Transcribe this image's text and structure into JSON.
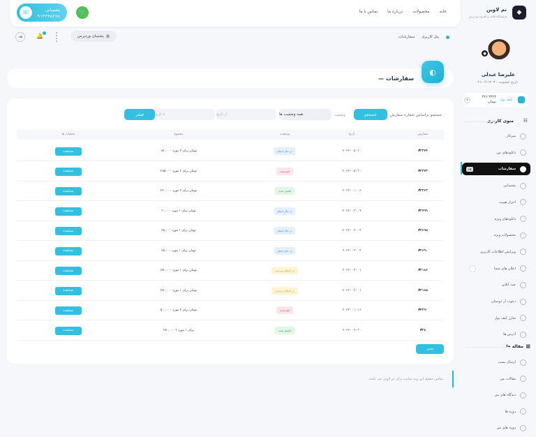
{
  "header": {
    "site_name": "تم لاوین",
    "site_tagline": "فروشگاه قالب و افزونه وردپرس",
    "nav": [
      "خانه",
      "محصولات",
      "درباره ما",
      "تماس با ما"
    ],
    "support_label": "پشتیبانی",
    "support_phone": "۰۹۱۳۳۴۵۶۷۸",
    "support_icon": "phone-icon",
    "cart_icon": "cart-icon"
  },
  "subbar": {
    "breadcrumb": [
      "پنل کاربری",
      "سفارشات"
    ],
    "wp_support": "پشتیبان وردپرس"
  },
  "profile": {
    "name": "علیرضا عبدلی",
    "reg_date": "تاریخ عضویت : ۱۴۰۳-۰۳-۲۱",
    "wallet_label": "کیف پول",
    "wallet_amount": "۳۳۶۳ ۳۶۶",
    "wallet_unit": "تومان",
    "wallet_plus": "+"
  },
  "sidebar": {
    "section1": "منوی کاربری",
    "items": [
      {
        "label": "میزکار",
        "icon": "dashboard-icon"
      },
      {
        "label": "دانلودهای من",
        "icon": "download-icon"
      },
      {
        "label": "سفارشات",
        "icon": "orders-icon",
        "active": true,
        "badge": "۱۷"
      },
      {
        "label": "پشتیبانی",
        "icon": "support-icon"
      },
      {
        "label": "احراز هویت",
        "icon": "id-icon"
      },
      {
        "label": "دانلودهای ویژه",
        "icon": "star-icon"
      },
      {
        "label": "محصولات ویژه",
        "icon": "pencil-icon"
      },
      {
        "label": "ویرایش اطلاعات کاربری",
        "icon": "edit-icon"
      },
      {
        "label": "اعلان های شما",
        "icon": "bell-icon",
        "circle": "۰"
      },
      {
        "label": "چت آنلاین",
        "icon": "chat-icon"
      },
      {
        "label": "دعوت از دوستان",
        "icon": "invite-icon"
      },
      {
        "label": "شارژ کیف پول",
        "icon": "wallet-icon"
      },
      {
        "label": "آدرس ها",
        "icon": "address-icon"
      }
    ],
    "section2": "مقاله ها",
    "items2": [
      {
        "label": "ارسال پست",
        "icon": "send-icon"
      },
      {
        "label": "مقالات من",
        "icon": "article-icon"
      },
      {
        "label": "دیدگاه های من",
        "icon": "comment-icon"
      },
      {
        "label": "دوره ها",
        "icon": "course-icon"
      },
      {
        "label": "دوره های من",
        "icon": "my-course-icon"
      }
    ]
  },
  "page": {
    "title": "سفارشات",
    "title_prefix": "—",
    "title_icon": "orders-icon"
  },
  "filters": {
    "search_label": "جستجو براساس شماره سفارش",
    "search_button": "جستجو",
    "status_label": "وضعیت",
    "status_value": "همه وضعیت ها",
    "from_placeholder": "از تاریخ",
    "to_placeholder": "تا تاریخ",
    "filter_button": "فیلتر"
  },
  "table": {
    "columns": [
      "سفارش",
      "تاریخ",
      "وضعیت",
      "مجموع",
      "عملیات ها"
    ],
    "rows": [
      {
        "id": "#۳۳۷۴",
        "date": "۲۰۲۴-۰۵-۳۰",
        "status": "در حال انجام",
        "status_type": "blue",
        "total": "۱۵۰,۰۰۰ تومان برای ۳ مورد",
        "action": "مشاهده"
      },
      {
        "id": "#۳۳۷۳",
        "date": "۲۰۲۴-۰۵-۳۰",
        "status": "لغو شده",
        "status_type": "red",
        "total": "۲۸۵,۰۰۰ تومان برای ۳ مورد",
        "action": "مشاهده"
      },
      {
        "id": "#۳۳۶۳",
        "date": "۲۰۲۴-۰۱-۰۶",
        "status": "تکمیل شده",
        "status_type": "green",
        "total": "۲۶۰,۰۰۰ تومان برای ۳ مورد",
        "action": "مشاهده"
      },
      {
        "id": "#۲۷۹۹",
        "date": "۲۰۲۳-۰۳-۰۹",
        "status": "در حال انجام",
        "status_type": "blue",
        "total": "۳۰,۰۰۰ تومان برای ۱ مورد",
        "action": "مشاهده"
      },
      {
        "id": "#۲۶۹۵",
        "date": "۲۰۲۳-۰۳-۰۴",
        "status": "در حال انجام",
        "status_type": "blue",
        "total": "۲۵,۰۰۰ تومان برای ۱ مورد",
        "action": "مشاهده"
      },
      {
        "id": "#۲۶۹۰",
        "date": "۲۰۲۳-۰۳-۰۴",
        "status": "در حال انجام",
        "status_type": "blue",
        "total": "۲۵,۰۰۰ تومان برای ۱ مورد",
        "action": "مشاهده"
      },
      {
        "id": "#۲۱۸۶",
        "date": "۲۰۲۳-۰۳-۰۱",
        "status": "در انتظار بررسی",
        "status_type": "yellow",
        "total": "۲۵۰,۰۰۰ تومان برای ۱ مورد",
        "action": "مشاهده"
      },
      {
        "id": "#۲۱۸۵",
        "date": "۲۰۲۳-۰۳-۰۱",
        "status": "در انتظار بررسی",
        "status_type": "yellow",
        "total": "۲۵۰,۰۰۰ تومان برای ۱ مورد",
        "action": "مشاهده"
      },
      {
        "id": "#۴۲۹۰",
        "date": "۲۰۲۳-۰۱-۱۶",
        "status": "لغو شده",
        "status_type": "red",
        "total": "۵۰۰,۰۰۰ تومان برای ۲ مورد",
        "action": "مشاهده"
      },
      {
        "id": "#۲۸",
        "date": "۲۰۲۲-۰۹-۳۰",
        "status": "تکمیل شده",
        "status_type": "green",
        "total": "۲۵۰,۰۰۰ ۲ برای ۱ مورد",
        "action": "مشاهده"
      }
    ],
    "next_button": "بعدی"
  },
  "footer": {
    "text": "تمامی حقوق این وب سایت برای تم لاوین می باشد."
  },
  "colors": {
    "accent": "#31c0e0",
    "dark": "#111111",
    "cart_green": "#4cc451"
  }
}
